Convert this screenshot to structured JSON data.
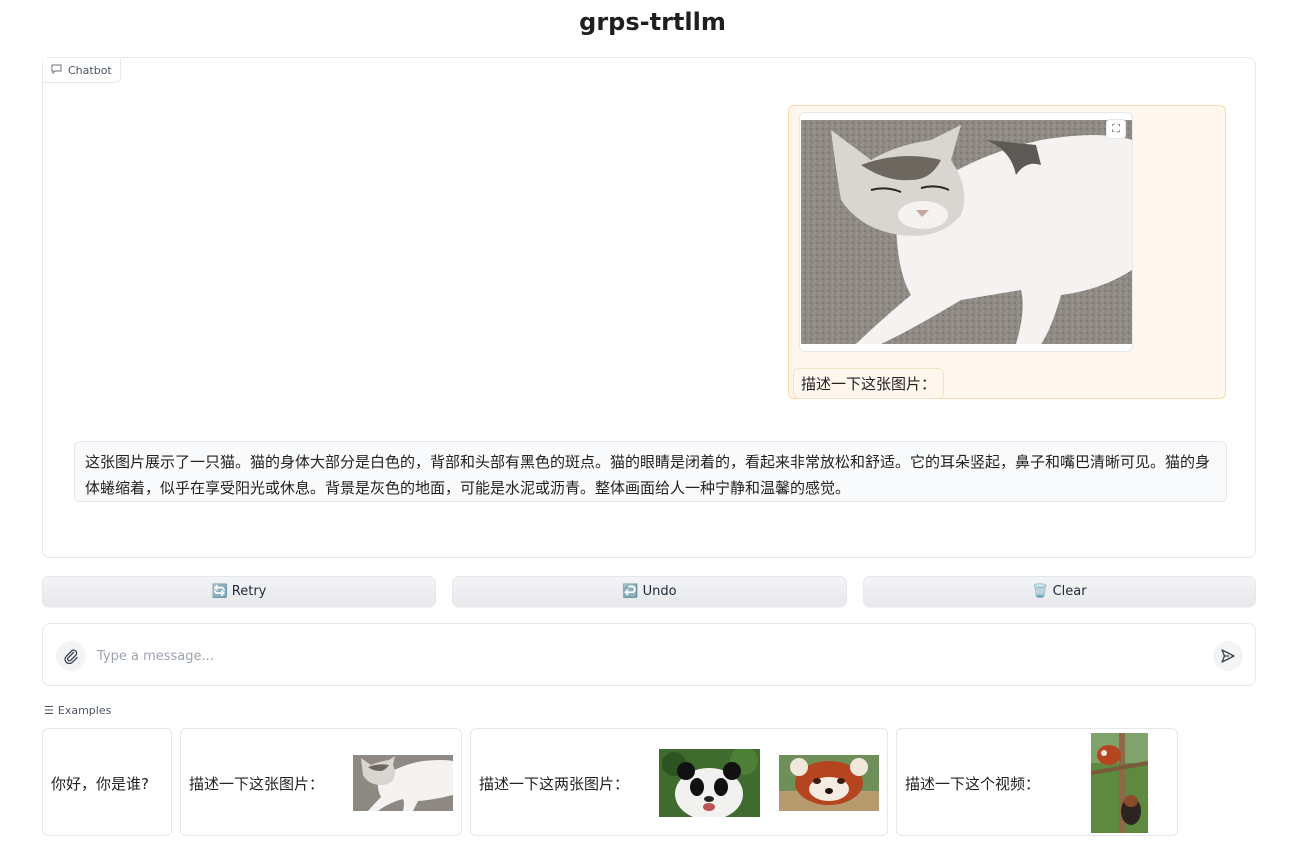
{
  "title": "grps-trtllm",
  "chatbot": {
    "label": "Chatbot",
    "user_text": "描述一下这张图片：",
    "bot_text": "这张图片展示了一只猫。猫的身体大部分是白色的，背部和头部有黑色的斑点。猫的眼睛是闭着的，看起来非常放松和舒适。它的耳朵竖起，鼻子和嘴巴清晰可见。猫的身体蜷缩着，似乎在享受阳光或休息。背景是灰色的地面，可能是水泥或沥青。整体画面给人一种宁静和温馨的感觉。"
  },
  "buttons": {
    "retry": "Retry",
    "undo": "Undo",
    "clear": "Clear"
  },
  "input": {
    "placeholder": "Type a message..."
  },
  "examples": {
    "label": "Examples",
    "items": [
      {
        "text": "你好，你是谁?"
      },
      {
        "text": "描述一下这张图片："
      },
      {
        "text": "描述一下这两张图片："
      },
      {
        "text": "描述一下这个视频："
      }
    ]
  },
  "colors": {
    "user_bubble": "#fff7ed",
    "user_border": "#fcd9a8",
    "bot_bubble": "#f9fafb"
  }
}
